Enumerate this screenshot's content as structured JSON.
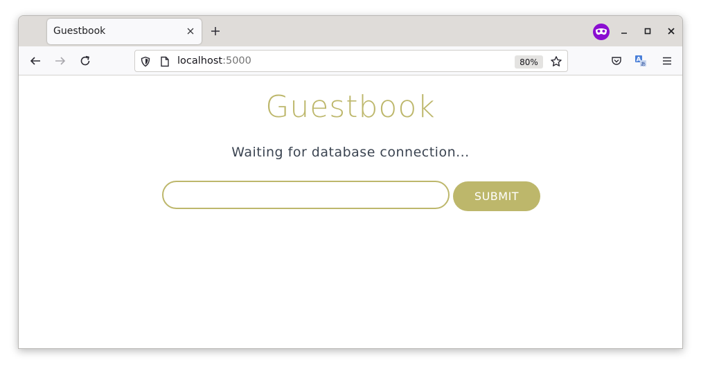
{
  "browser": {
    "tab": {
      "title": "Guestbook"
    },
    "url": {
      "host": "localhost",
      "port": ":5000"
    },
    "zoom": "80%",
    "icons": {
      "back": "arrow-left-icon",
      "forward": "arrow-right-icon",
      "reload": "reload-icon",
      "shield": "tracking-shield-icon",
      "page": "page-icon",
      "bookmark": "star-icon",
      "pocket": "pocket-icon",
      "translate": "translate-icon",
      "menu": "hamburger-menu-icon",
      "account": "private-browsing-mask-icon"
    }
  },
  "page": {
    "title": "Guestbook",
    "status": "Waiting for database connection...",
    "input": {
      "value": "",
      "placeholder": ""
    },
    "submit_label": "SUBMIT"
  },
  "colors": {
    "accent": "#bdb76b",
    "status_text": "#3b4451",
    "account_badge": "#8a0dd1"
  }
}
